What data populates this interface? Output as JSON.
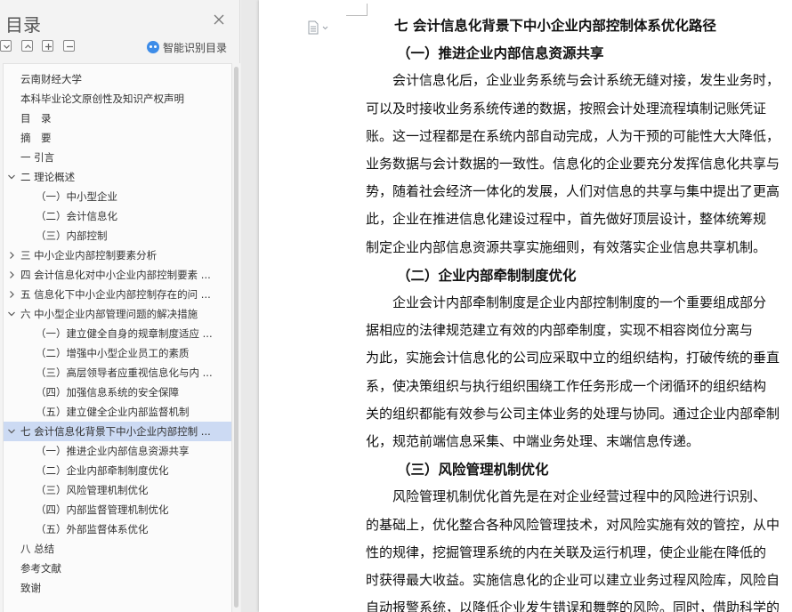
{
  "nav": {
    "title": "目录",
    "smart_recognition": "智能识别目录",
    "toc": [
      {
        "label": "云南财经大学",
        "level": 0,
        "expander": "none"
      },
      {
        "label": "本科毕业论文原创性及知识产权声明",
        "level": 0,
        "expander": "none"
      },
      {
        "label": "目　录",
        "level": 0,
        "expander": "none"
      },
      {
        "label": "摘　要",
        "level": 0,
        "expander": "none"
      },
      {
        "label": "一 引言",
        "level": 0,
        "expander": "none"
      },
      {
        "label": "二 理论概述",
        "level": 0,
        "expander": "expanded"
      },
      {
        "label": "（一）中小型企业",
        "level": 1,
        "expander": "none"
      },
      {
        "label": "（二）会计信息化",
        "level": 1,
        "expander": "none"
      },
      {
        "label": "（三）内部控制",
        "level": 1,
        "expander": "none"
      },
      {
        "label": "三 中小企业内部控制要素分析",
        "level": 0,
        "expander": "collapsed"
      },
      {
        "label": "四 会计信息化对中小企业内部控制要素 ...",
        "level": 0,
        "expander": "collapsed"
      },
      {
        "label": "五 信息化下中小企业内部控制存在的问 ...",
        "level": 0,
        "expander": "collapsed"
      },
      {
        "label": "六 中小型企业内部管理问题的解决措施",
        "level": 0,
        "expander": "expanded"
      },
      {
        "label": "（一）建立健全自身的规章制度适应 ...",
        "level": 1,
        "expander": "none"
      },
      {
        "label": "（二）增强中小型企业员工的素质",
        "level": 1,
        "expander": "none"
      },
      {
        "label": "（三）高层领导者应重视信息化与内 ...",
        "level": 1,
        "expander": "none"
      },
      {
        "label": "（四）加强信息系统的安全保障",
        "level": 1,
        "expander": "none"
      },
      {
        "label": "（五）建立健全企业内部监督机制",
        "level": 1,
        "expander": "none"
      },
      {
        "label": "七 会计信息化背景下中小企业内部控制 ...",
        "level": 0,
        "expander": "expanded",
        "selected": true
      },
      {
        "label": "（一）推进企业内部信息资源共享",
        "level": 1,
        "expander": "none"
      },
      {
        "label": "（二）企业内部牵制制度优化",
        "level": 1,
        "expander": "none"
      },
      {
        "label": "（三）风险管理机制优化",
        "level": 1,
        "expander": "none"
      },
      {
        "label": "（四）内部监督管理机制优化",
        "level": 1,
        "expander": "none"
      },
      {
        "label": "（五）外部监督体系优化",
        "level": 1,
        "expander": "none"
      },
      {
        "label": "八 总结",
        "level": 0,
        "expander": "none"
      },
      {
        "label": "参考文献",
        "level": 0,
        "expander": "none"
      },
      {
        "label": "致谢",
        "level": 0,
        "expander": "none"
      }
    ]
  },
  "doc": {
    "lines": [
      {
        "kind": "h1",
        "text": "七 会计信息化背景下中小企业内部控制体系优化路径"
      },
      {
        "kind": "h2",
        "text": "（一）推进企业内部信息资源共享"
      },
      {
        "kind": "p",
        "text": "　　会计信息化后，企业业务系统与会计系统无缝对接，发生业务时，"
      },
      {
        "kind": "p",
        "text": "可以及时接收业务系统传递的数据，按照会计处理流程填制记账凭证"
      },
      {
        "kind": "p",
        "text": "账。这一过程都是在系统内部自动完成，人为干预的可能性大大降低，"
      },
      {
        "kind": "p",
        "text": "业务数据与会计数据的一致性。信息化的企业要充分发挥信息化共享与"
      },
      {
        "kind": "p",
        "text": "势，随着社会经济一体化的发展，人们对信息的共享与集中提出了更高"
      },
      {
        "kind": "p",
        "text": "此，企业在推进信息化建设过程中，首先做好顶层设计，整体统筹规"
      },
      {
        "kind": "p",
        "text": "制定企业内部信息资源共享实施细则，有效落实企业信息共享机制。"
      },
      {
        "kind": "h2",
        "text": "（二）企业内部牵制制度优化"
      },
      {
        "kind": "p",
        "text": "　　企业会计内部牵制制度是企业内部控制制度的一个重要组成部分"
      },
      {
        "kind": "p",
        "text": "据相应的法律规范建立有效的内部牵制度，实现不相容岗位分离与"
      },
      {
        "kind": "p",
        "text": "为此，实施会计信息化的公司应采取中立的组织结构，打破传统的垂直"
      },
      {
        "kind": "p",
        "text": "系，使决策组织与执行组织围绕工作任务形成一个闭循环的组织结构"
      },
      {
        "kind": "p",
        "text": "关的组织都能有效参与公司主体业务的处理与协同。通过企业内部牵制"
      },
      {
        "kind": "p",
        "text": "化，规范前端信息采集、中端业务处理、末端信息传递。"
      },
      {
        "kind": "h2",
        "text": "（三）风险管理机制优化"
      },
      {
        "kind": "p",
        "text": "　　风险管理机制优化首先是在对企业经营过程中的风险进行识别、"
      },
      {
        "kind": "p",
        "text": "的基础上，优化整合各种风险管理技术，对风险实施有效的管控，从中"
      },
      {
        "kind": "p",
        "text": "性的规律，挖掘管理系统的内在关联及运行机理，使企业能在降低的"
      },
      {
        "kind": "p",
        "text": "时获得最大收益。实施信息化的企业可以建立业务过程风险库，风险自"
      },
      {
        "kind": "p",
        "text": "自动报警系统，以降低企业发生错误和舞弊的风险。同时，借助科学的"
      }
    ]
  },
  "colors": {
    "accent": "#3d8ce8",
    "selected_bg": "#ccdaf3"
  }
}
